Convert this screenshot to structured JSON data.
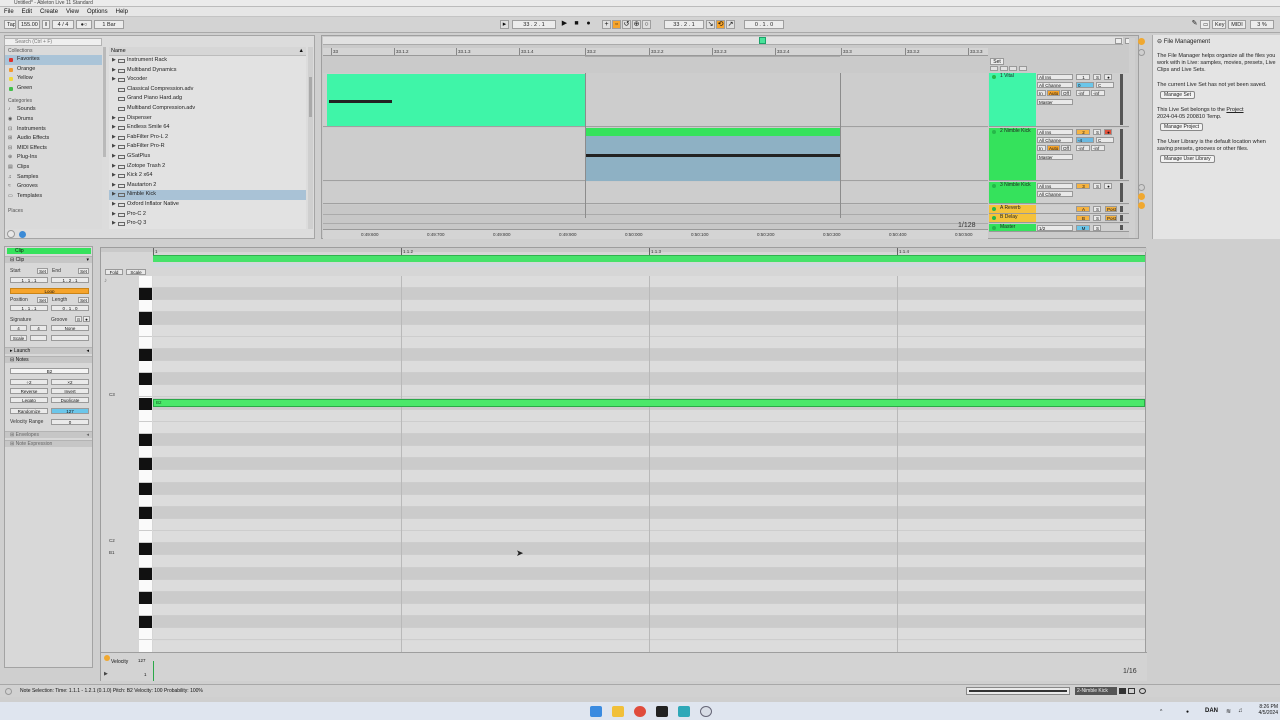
{
  "window": {
    "title": "Untitled* - Ableton Live 11 Standard"
  },
  "menu": [
    "File",
    "Edit",
    "Create",
    "View",
    "Options",
    "Help"
  ],
  "transport": {
    "tap": "Tap",
    "tempo": "155.00",
    "signature": "4 / 4",
    "quant": "1 Bar",
    "position": "33 . 2 . 1",
    "loop_start": "33 . 2 . 1",
    "loop_length": "0 . 1 . 0",
    "key": "Key",
    "midi": "MIDI",
    "cpu": "3 %"
  },
  "browser": {
    "search_placeholder": "Search (Ctrl + F)",
    "collections_label": "Collections",
    "collections": [
      {
        "label": "Favorites",
        "color": "#e0302a",
        "selected": true
      },
      {
        "label": "Orange",
        "color": "#f29a2e"
      },
      {
        "label": "Yellow",
        "color": "#f0d83a"
      },
      {
        "label": "Green",
        "color": "#43c04a"
      }
    ],
    "categories_label": "Categories",
    "categories": [
      "Sounds",
      "Drums",
      "Instruments",
      "Audio Effects",
      "MIDI Effects",
      "Plug-Ins",
      "Clips",
      "Samples",
      "Grooves",
      "Templates"
    ],
    "places_label": "Places",
    "name_header": "Name",
    "files": [
      {
        "label": "Instrument Rack",
        "folder": true
      },
      {
        "label": "Multiband Dynamics",
        "folder": true
      },
      {
        "label": "Vocoder",
        "folder": true
      },
      {
        "label": "Classical Compression.adv",
        "folder": false
      },
      {
        "label": "Grand Piano Hard.adg",
        "folder": false
      },
      {
        "label": "Multiband Compression.adv",
        "folder": false
      },
      {
        "label": "Dispenser",
        "folder": true
      },
      {
        "label": "Endless Smile 64",
        "folder": true
      },
      {
        "label": "FabFilter Pro-L 2",
        "folder": true
      },
      {
        "label": "FabFilter Pro-R",
        "folder": true
      },
      {
        "label": "GSatPlus",
        "folder": true
      },
      {
        "label": "iZotope Trash 2",
        "folder": true
      },
      {
        "label": "Kick 2 x64",
        "folder": true
      },
      {
        "label": "Mautarton 2",
        "folder": true
      },
      {
        "label": "Nimble Kick",
        "folder": true,
        "selected": true
      },
      {
        "label": "Oxford Inflator Native",
        "folder": true
      },
      {
        "label": "Pro-C 2",
        "folder": true
      },
      {
        "label": "Pro-Q 3",
        "folder": true
      }
    ]
  },
  "arrangement": {
    "ruler": [
      "33",
      "33.1.2",
      "33.1.3",
      "33.1.4",
      "33.2",
      "33.2.2",
      "33.2.3",
      "33.2.4",
      "33.3",
      "33.3.2",
      "33.3.3"
    ],
    "time_ruler": [
      "0:49:600",
      "0:49:700",
      "0:49:800",
      "0:49:900",
      "0:50:000",
      "0:50:100",
      "0:50:200",
      "0:50:300",
      "0:50:400",
      "0:50:500"
    ],
    "zoom": "1/128",
    "set_label": "Set",
    "tracks": [
      {
        "num": "1",
        "name": "1 Vital",
        "color": "#3ff5a8",
        "input": "All Ins",
        "channel": "All Channe",
        "auto": "Auto",
        "out": "Master",
        "vol": "0",
        "pan": "C"
      },
      {
        "num": "2",
        "name": "2 Nimble Kick",
        "color": "#35e25c",
        "input": "All Ins",
        "channel": "All Channe",
        "auto": "Auto",
        "out": "Master",
        "vol": "-4",
        "pan": "C"
      },
      {
        "num": "3",
        "name": "3 Nimble Kick",
        "color": "#35e25c",
        "input": "All Ins",
        "channel": "All Channe"
      },
      {
        "num": "A",
        "name": "A Reverb",
        "color": "#f5c23b"
      },
      {
        "num": "B",
        "name": "B Delay",
        "color": "#f5c23b"
      },
      {
        "num": "M",
        "name": "Master",
        "color": "#35e25c",
        "out": "1/2"
      }
    ],
    "mix_fx": [
      "-inf",
      "-inf"
    ]
  },
  "help": {
    "title": "File Management",
    "p1": "The File Manager helps organize all the files you work with in Live: samples, movies, presets, Live Clips and Live Sets.",
    "p2": "The current Live Set has not yet been saved.",
    "btn1": "Manage Set",
    "p3a": "This Live Set belongs to the",
    "p3link": "Project",
    "p3b": "2024-04-05 200810 Temp.",
    "btn2": "Manage Project",
    "p4": "The User Library is the default location when saving presets, grooves or other files.",
    "btn3": "Manage User Library"
  },
  "clip": {
    "header": "Clip",
    "section": "Clip",
    "start": "Start",
    "end": "End",
    "start_val": "1 . 1 . 1",
    "end_val": "1 . 2 . 1",
    "loop": "Loop",
    "position": "Position",
    "length": "Length",
    "pos_val": "1 . 1 . 1",
    "len_val": "0 . 1 . 0",
    "signature": "Signature",
    "groove": "Groove",
    "sig_num": "4",
    "sig_den": "4",
    "groove_val": "None",
    "scale": "Scale",
    "launch": "Launch",
    "notes": "Notes",
    "note_name": "B2",
    "x2": "÷2",
    "times2": "×2",
    "reverse": "Reverse",
    "invert": "Invert",
    "legato": "Legato",
    "duplicate": "Duplicate",
    "randomize": "Randomize",
    "rand_val": "127",
    "vel_range": "Velocity Range",
    "vel_range_val": "0",
    "envelopes": "Envelopes",
    "note_expression": "Note Expression"
  },
  "editor": {
    "fold": "Fold",
    "scale": "Scale",
    "ruler": [
      "1",
      "1.1.2",
      "1.1.3",
      "1.1.4"
    ],
    "key_labels": [
      "C3",
      "C2",
      "B1"
    ],
    "note_label": "B2",
    "velocity_label": "Velocity",
    "vel_max": "127",
    "vel_min": "1",
    "zoom": "1/16"
  },
  "status": {
    "text": "Note Selection:  Time: 1.1.1 - 1.2.1 (0.1.0)    Pitch: B2    Velocity: 100    Probability: 100%",
    "track": "2-Nimble Kick"
  },
  "taskbar": {
    "lang": "DAN",
    "time": "8:26 PM",
    "date": "4/5/2024"
  }
}
